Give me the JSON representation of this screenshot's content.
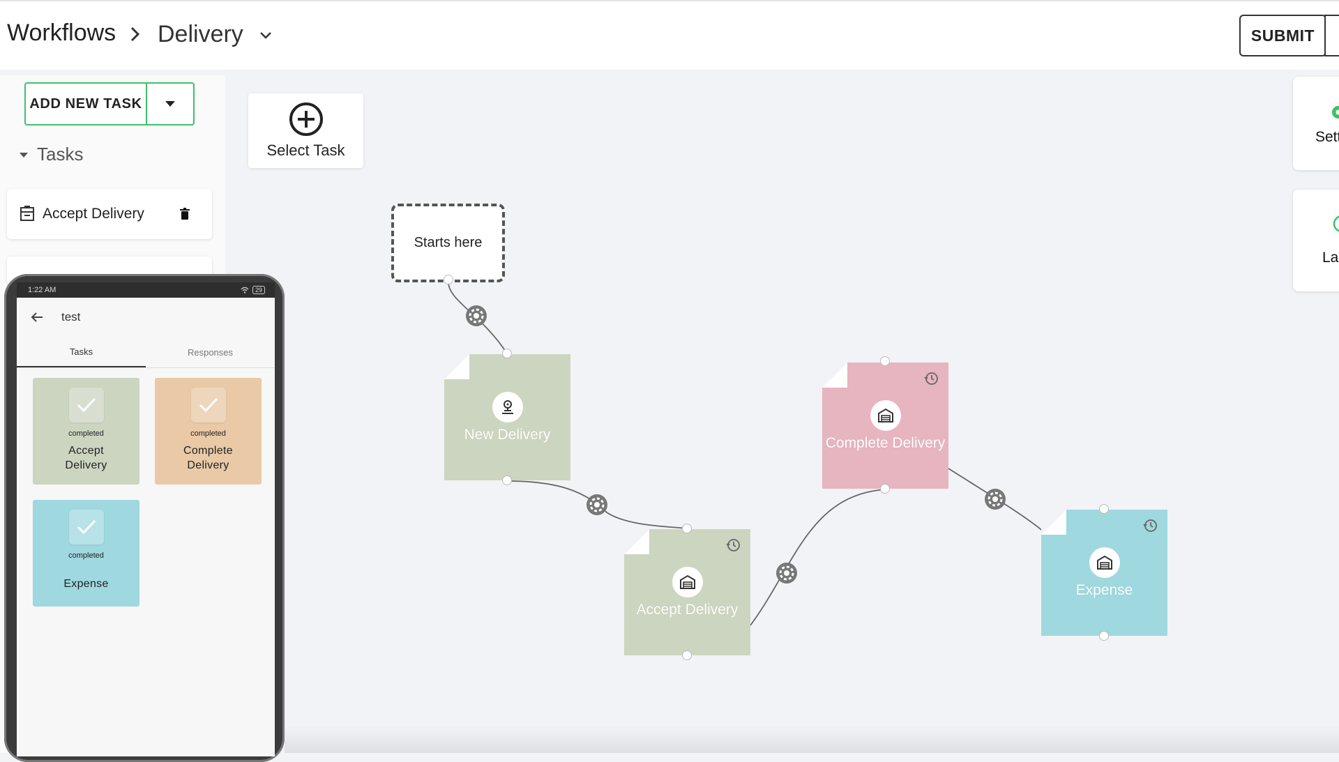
{
  "header": {
    "breadcrumb_root": "Workflows",
    "breadcrumb_current": "Delivery",
    "submit_label": "SUBMIT"
  },
  "sidebar": {
    "add_task_label": "ADD NEW TASK",
    "tasks_heading": "Tasks",
    "tasks": [
      {
        "label": "Accept Delivery"
      }
    ]
  },
  "canvas": {
    "select_task_label": "Select Task",
    "start_label": "Starts here",
    "nodes": [
      {
        "label": "New Delivery",
        "color": "#ccd5c0",
        "icon": "location-person-icon"
      },
      {
        "label": "Accept Delivery",
        "color": "#ccd5c0",
        "icon": "warehouse-icon"
      },
      {
        "label": "Complete Delivery",
        "color": "#e6b5bf",
        "icon": "warehouse-icon"
      },
      {
        "label": "Expense",
        "color": "#9fd8df",
        "icon": "warehouse-icon"
      }
    ]
  },
  "right_panel": {
    "settings_label": "Sett",
    "la_label": "La"
  },
  "phone": {
    "time": "1:22 AM",
    "battery": "29",
    "title": "test",
    "tabs": [
      "Tasks",
      "Responses"
    ],
    "active_tab": "Tasks",
    "tiles": [
      {
        "status": "completed",
        "name": "Accept Delivery",
        "color": "#ccd5c0"
      },
      {
        "status": "completed",
        "name": "Complete Delivery",
        "color": "#e9c9a6"
      },
      {
        "status": "completed",
        "name": "Expense",
        "color": "#9fd8df"
      }
    ]
  },
  "colors": {
    "accent_green": "#3cc26a"
  }
}
